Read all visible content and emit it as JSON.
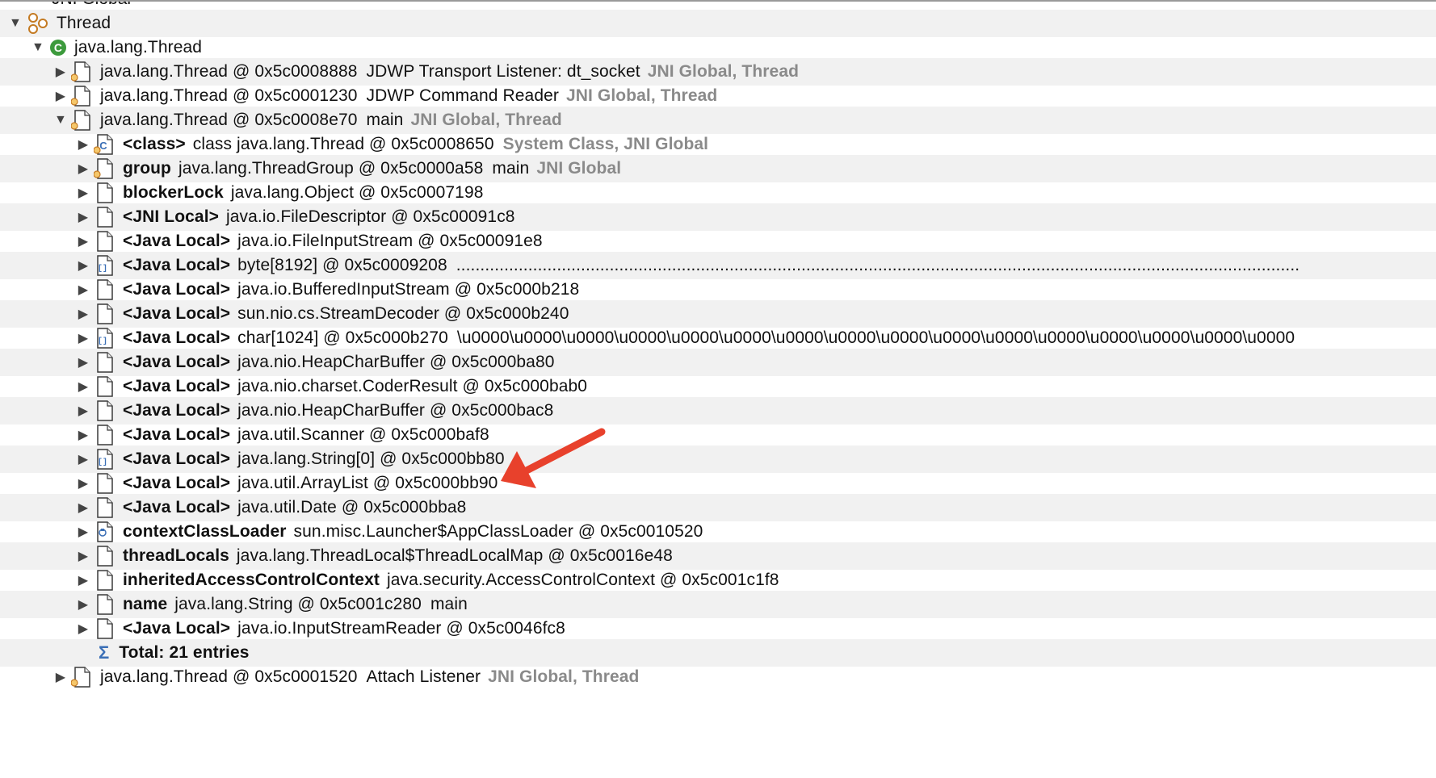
{
  "top_partial_label": "JNI Global",
  "thread_category": "Thread",
  "thread_class": "java.lang.Thread",
  "threads": [
    {
      "object": "java.lang.Thread @ 0x5c0008888",
      "extra": "JDWP Transport Listener: dt_socket",
      "tags": "JNI Global, Thread"
    },
    {
      "object": "java.lang.Thread @ 0x5c0001230",
      "extra": "JDWP Command Reader",
      "tags": "JNI Global, Thread"
    },
    {
      "object": "java.lang.Thread @ 0x5c0008e70",
      "extra": "main",
      "tags": "JNI Global, Thread"
    },
    {
      "object": "java.lang.Thread @ 0x5c0001520",
      "extra": "Attach Listener",
      "tags": "JNI Global, Thread"
    }
  ],
  "children": [
    {
      "field": "<class>",
      "object": "class java.lang.Thread @ 0x5c0008650",
      "extra": "",
      "tags": "System Class, JNI Global",
      "icon": "class-object-icon"
    },
    {
      "field": "group",
      "object": "java.lang.ThreadGroup @ 0x5c0000a58",
      "extra": "main",
      "tags": "JNI Global",
      "icon": "gc-root-object-icon"
    },
    {
      "field": "blockerLock",
      "object": "java.lang.Object @ 0x5c0007198",
      "extra": "",
      "tags": "",
      "icon": "object-icon"
    },
    {
      "field": "<JNI Local>",
      "object": "java.io.FileDescriptor @ 0x5c00091c8",
      "extra": "",
      "tags": "",
      "icon": "object-icon"
    },
    {
      "field": "<Java Local>",
      "object": "java.io.FileInputStream @ 0x5c00091e8",
      "extra": "",
      "tags": "",
      "icon": "object-icon"
    },
    {
      "field": "<Java Local>",
      "object": "byte[8192] @ 0x5c0009208",
      "extra": "................................................................................................................................................................................",
      "tags": "",
      "icon": "array-icon"
    },
    {
      "field": "<Java Local>",
      "object": "java.io.BufferedInputStream @ 0x5c000b218",
      "extra": "",
      "tags": "",
      "icon": "object-icon"
    },
    {
      "field": "<Java Local>",
      "object": "sun.nio.cs.StreamDecoder @ 0x5c000b240",
      "extra": "",
      "tags": "",
      "icon": "object-icon"
    },
    {
      "field": "<Java Local>",
      "object": "char[1024] @ 0x5c000b270",
      "extra": "\\u0000\\u0000\\u0000\\u0000\\u0000\\u0000\\u0000\\u0000\\u0000\\u0000\\u0000\\u0000\\u0000\\u0000\\u0000\\u0000",
      "tags": "",
      "icon": "array-icon"
    },
    {
      "field": "<Java Local>",
      "object": "java.nio.HeapCharBuffer @ 0x5c000ba80",
      "extra": "",
      "tags": "",
      "icon": "object-icon"
    },
    {
      "field": "<Java Local>",
      "object": "java.nio.charset.CoderResult @ 0x5c000bab0",
      "extra": "",
      "tags": "",
      "icon": "object-icon"
    },
    {
      "field": "<Java Local>",
      "object": "java.nio.HeapCharBuffer @ 0x5c000bac8",
      "extra": "",
      "tags": "",
      "icon": "object-icon"
    },
    {
      "field": "<Java Local>",
      "object": "java.util.Scanner @ 0x5c000baf8",
      "extra": "",
      "tags": "",
      "icon": "object-icon"
    },
    {
      "field": "<Java Local>",
      "object": "java.lang.String[0] @ 0x5c000bb80",
      "extra": "",
      "tags": "",
      "icon": "array-icon"
    },
    {
      "field": "<Java Local>",
      "object": "java.util.ArrayList @ 0x5c000bb90",
      "extra": "",
      "tags": "",
      "icon": "object-icon"
    },
    {
      "field": "<Java Local>",
      "object": "java.util.Date @ 0x5c000bba8",
      "extra": "",
      "tags": "",
      "icon": "object-icon"
    },
    {
      "field": "contextClassLoader",
      "object": "sun.misc.Launcher$AppClassLoader @ 0x5c0010520",
      "extra": "",
      "tags": "",
      "icon": "classloader-icon"
    },
    {
      "field": "threadLocals",
      "object": "java.lang.ThreadLocal$ThreadLocalMap @ 0x5c0016e48",
      "extra": "",
      "tags": "",
      "icon": "object-icon"
    },
    {
      "field": "inheritedAccessControlContext",
      "object": "java.security.AccessControlContext @ 0x5c001c1f8",
      "extra": "",
      "tags": "",
      "icon": "object-icon"
    },
    {
      "field": "name",
      "object": "java.lang.String @ 0x5c001c280",
      "extra": "main",
      "tags": "",
      "icon": "object-icon"
    },
    {
      "field": "<Java Local>",
      "object": "java.io.InputStreamReader @ 0x5c0046fc8",
      "extra": "",
      "tags": "",
      "icon": "object-icon"
    }
  ],
  "total_label": "Total: 21 entries",
  "colors": {
    "row_alt": "#f1f1f1",
    "tag_gray": "#8a8a8a",
    "class_green": "#3c9a3c",
    "gc_root_orange": "#e0a040",
    "array_blue": "#3b6fb6",
    "arrow_red": "#e8412c"
  }
}
